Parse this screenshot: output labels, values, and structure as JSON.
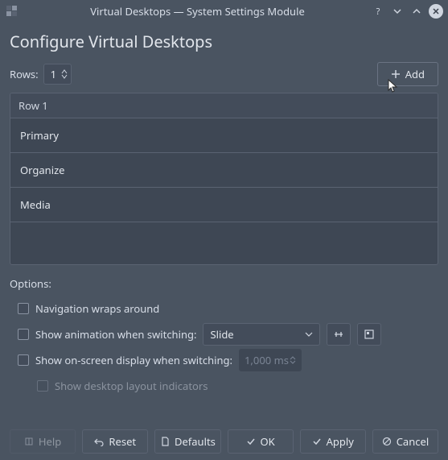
{
  "titlebar": {
    "title": "Virtual Desktops — System Settings Module"
  },
  "header": {
    "title": "Configure Virtual Desktops"
  },
  "rows": {
    "label": "Rows:",
    "value": "1"
  },
  "add_button": {
    "label": "Add"
  },
  "list": {
    "row_header": "Row 1",
    "items": [
      "Primary",
      "Organize",
      "Media"
    ]
  },
  "options": {
    "title": "Options:",
    "nav_wraps": "Navigation wraps around",
    "show_animation": "Show animation when switching:",
    "animation_value": "Slide",
    "show_osd": "Show on-screen display when switching:",
    "osd_duration": "1,000 ms",
    "show_layout_indicators": "Show desktop layout indicators"
  },
  "buttons": {
    "help": "Help",
    "reset": "Reset",
    "defaults": "Defaults",
    "ok": "OK",
    "apply": "Apply",
    "cancel": "Cancel"
  }
}
